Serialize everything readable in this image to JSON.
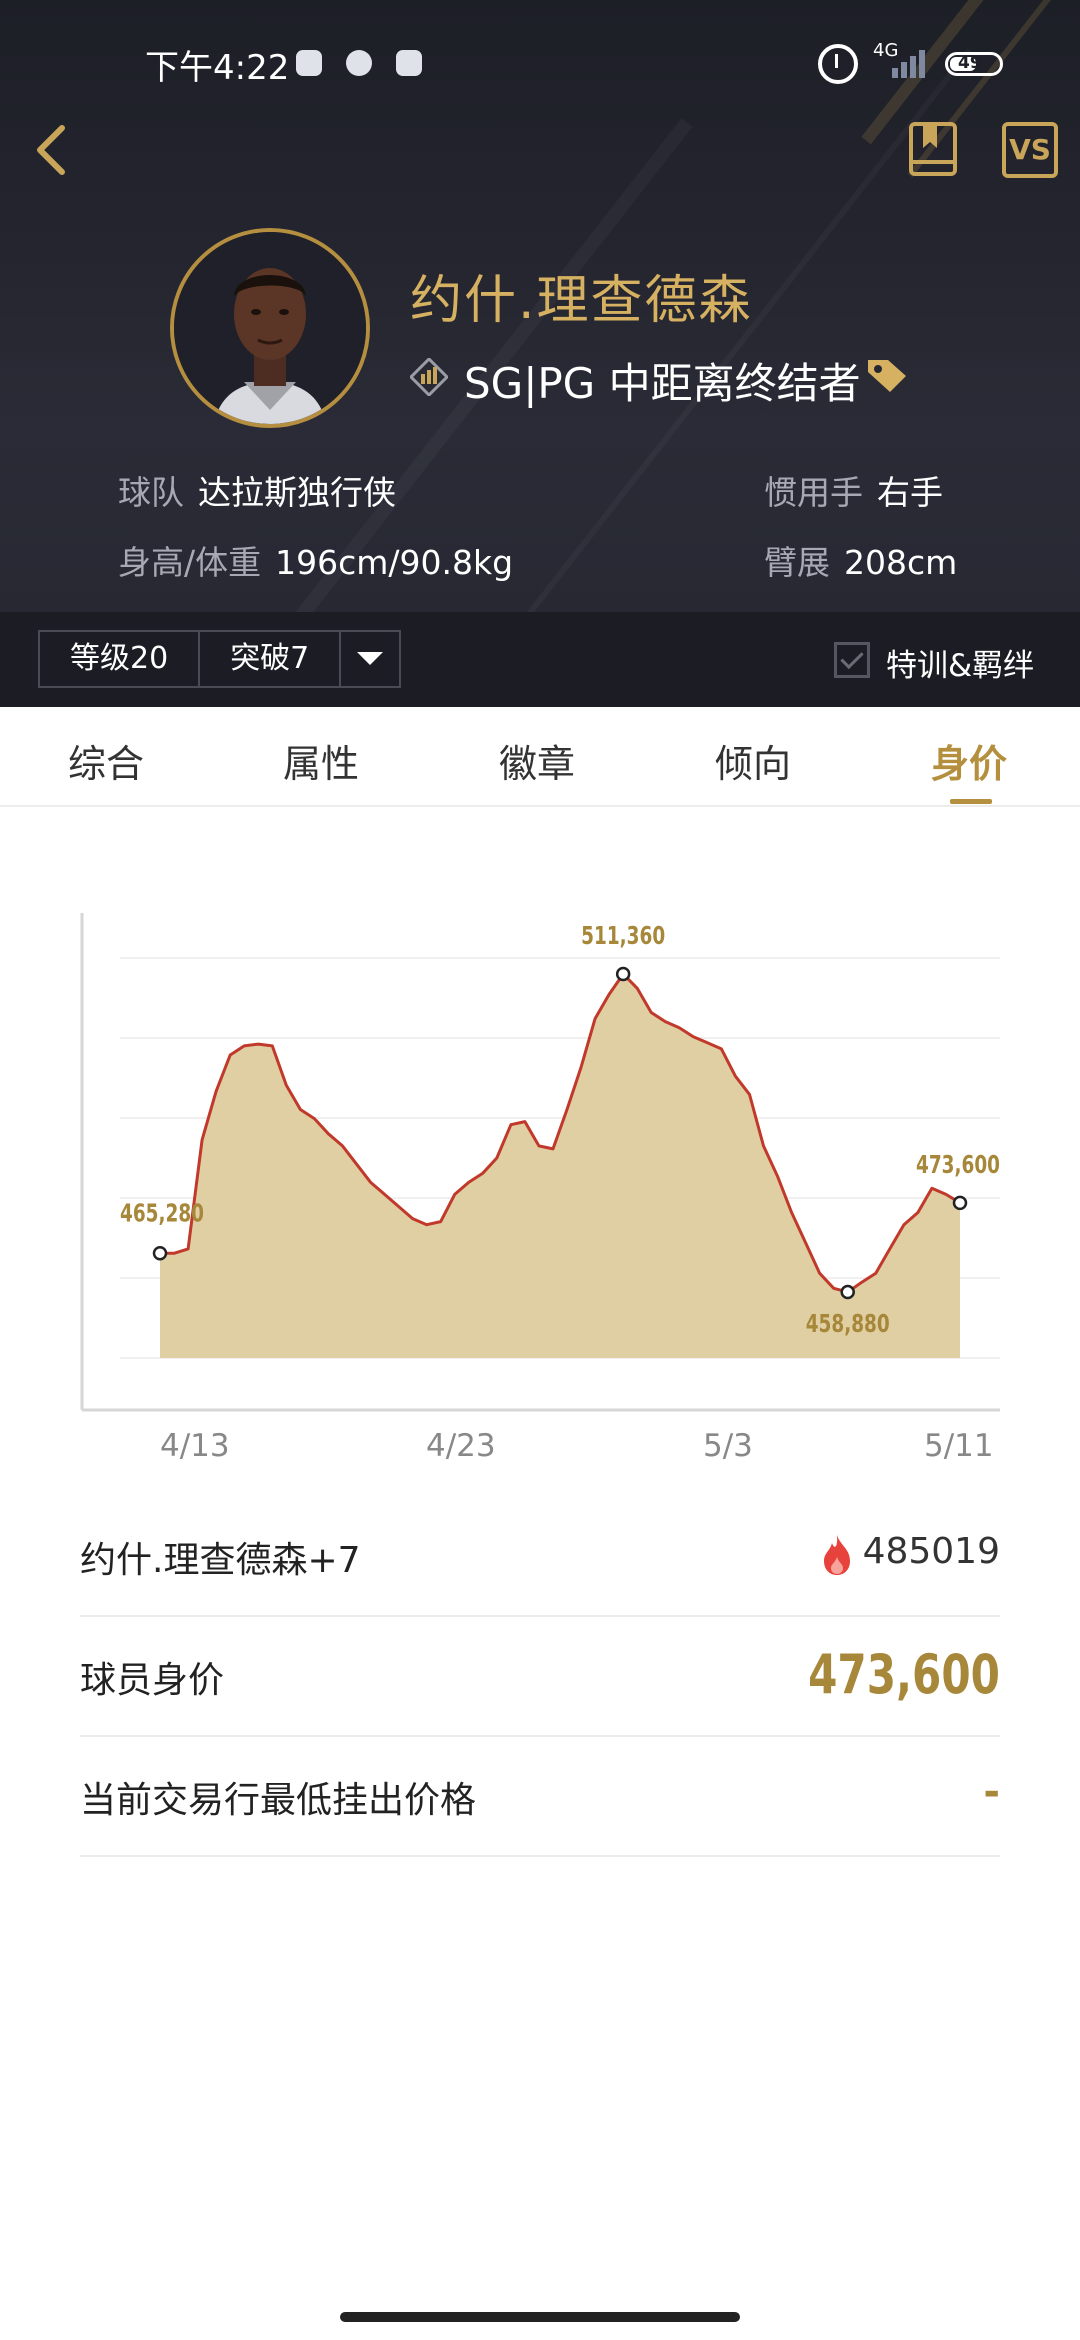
{
  "status_bar": {
    "time": "下午4:22",
    "network": "4G",
    "battery": "49"
  },
  "nav": {
    "vs_label": "VS"
  },
  "player": {
    "name": "约什.理查德森",
    "position": "SG|PG 中距离终结者",
    "team_label": "球队",
    "team": "达拉斯独行侠",
    "hand_label": "惯用手",
    "hand": "右手",
    "body_label": "身高/体重",
    "body": "196cm/90.8kg",
    "wingspan_label": "臂展",
    "wingspan": "208cm"
  },
  "level_bar": {
    "level": "等级20",
    "breakthrough": "突破7",
    "training_label": "特训&羁绊"
  },
  "tabs": [
    {
      "label": "综合"
    },
    {
      "label": "属性"
    },
    {
      "label": "徽章"
    },
    {
      "label": "倾向"
    },
    {
      "label": "身价"
    }
  ],
  "active_tab": "身价",
  "chart_data": {
    "type": "area",
    "title": "",
    "xlabel": "",
    "ylabel": "",
    "x_ticks": [
      "4/13",
      "4/23",
      "5/3",
      "5/11"
    ],
    "annotations": [
      {
        "label": "465,280",
        "value": 465280,
        "point": "start"
      },
      {
        "label": "511,360",
        "value": 511360,
        "point": "max"
      },
      {
        "label": "458,880",
        "value": 458880,
        "point": "min"
      },
      {
        "label": "473,600",
        "value": 473600,
        "point": "end"
      }
    ],
    "series": [
      {
        "values": [
          465280,
          465280,
          466000,
          484000,
          492000,
          498000,
          499500,
          499800,
          499500,
          493000,
          489000,
          487500,
          485000,
          483000,
          480000,
          477000,
          475000,
          473000,
          471000,
          470000,
          470500,
          475000,
          477000,
          478500,
          481000,
          486500,
          487000,
          483000,
          482500,
          489000,
          496000,
          504000,
          508000,
          511360,
          509000,
          505000,
          503500,
          502500,
          501000,
          500000,
          499000,
          494500,
          491500,
          483000,
          478000,
          472000,
          467000,
          462000,
          459500,
          458880,
          460500,
          462000,
          466000,
          470000,
          472000,
          476000,
          475000,
          473600
        ],
        "color": "#c0392b",
        "fill": "#e0cfa3"
      }
    ],
    "ylim": [
      448000,
      514000
    ],
    "grid": true
  },
  "rows": {
    "heat_label": "约什.理查德森+7",
    "heat_value": "485019",
    "value_label": "球员身价",
    "value": "473,600",
    "lowest_label": "当前交易行最低挂出价格",
    "lowest": "-"
  },
  "colors": {
    "gold": "#b38f3e",
    "line": "#c0392b",
    "area": "#e0cfa3",
    "header": "#1d1f27"
  }
}
